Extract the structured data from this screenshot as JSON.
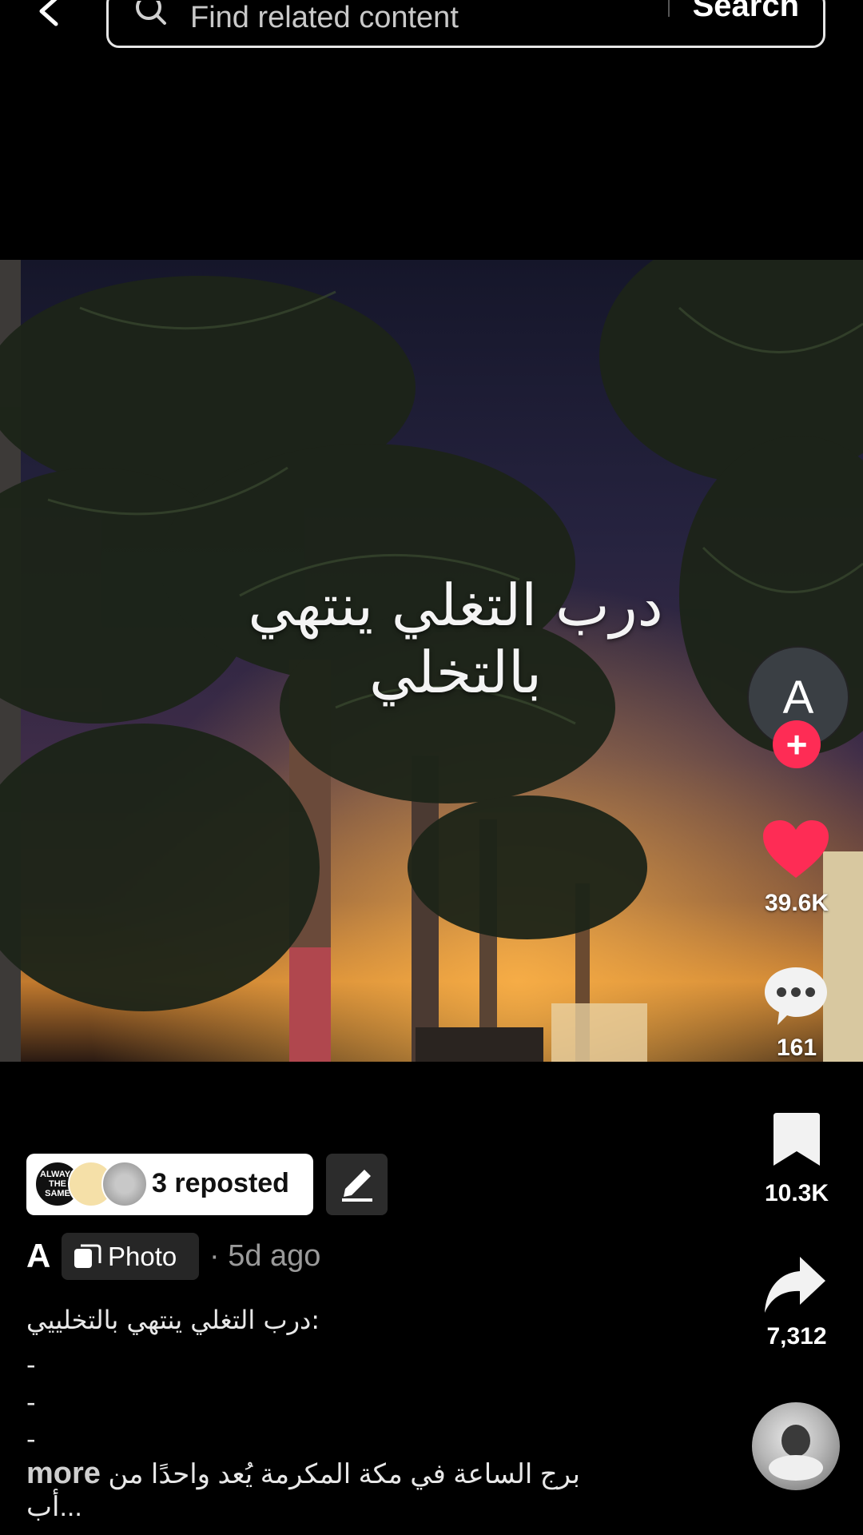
{
  "search": {
    "placeholder": "Find related content",
    "submit_label": "Search"
  },
  "photo": {
    "overlay_text": "درب التغلي ينتهي بالتخلي"
  },
  "rail": {
    "author_initial": "A",
    "follow_symbol": "+",
    "likes": "39.6K",
    "comments": "161",
    "saves": "10.3K",
    "shares": "7,312"
  },
  "repost": {
    "avatar_text": "ALWAYS THE SAME",
    "label": "3 reposted"
  },
  "post": {
    "author": "A",
    "type_label": "Photo",
    "time": "· 5d ago",
    "caption_line1": "درب التغلي ينتهي بالتخلييي:",
    "dash": "-",
    "caption_last": "برج الساعة في مكة المكرمة يُعد واحدًا من أب...",
    "more_label": "more"
  },
  "colors": {
    "like": "#fe2c55",
    "follow": "#fe2c55",
    "background": "#000000"
  }
}
